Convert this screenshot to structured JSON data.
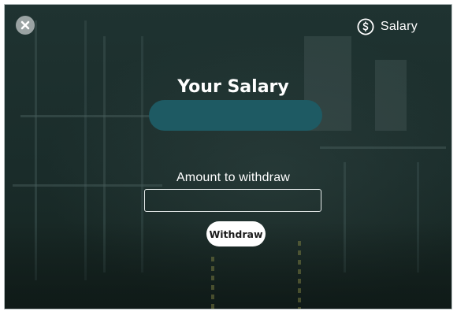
{
  "header": {
    "close_icon": "close-icon",
    "badge_icon": "dollar-circle-icon",
    "badge_label": "Salary"
  },
  "main": {
    "title": "Your Salary",
    "salary_value": "",
    "amount_label": "Amount to withdraw",
    "amount_input_value": "",
    "amount_input_placeholder": "",
    "withdraw_button_label": "Withdraw"
  },
  "colors": {
    "overlay": "#1b2e2c",
    "salary_pill": "#1e5a63",
    "close_button": "#9aa3a3",
    "text": "#ffffff",
    "button_bg": "#ffffff"
  }
}
